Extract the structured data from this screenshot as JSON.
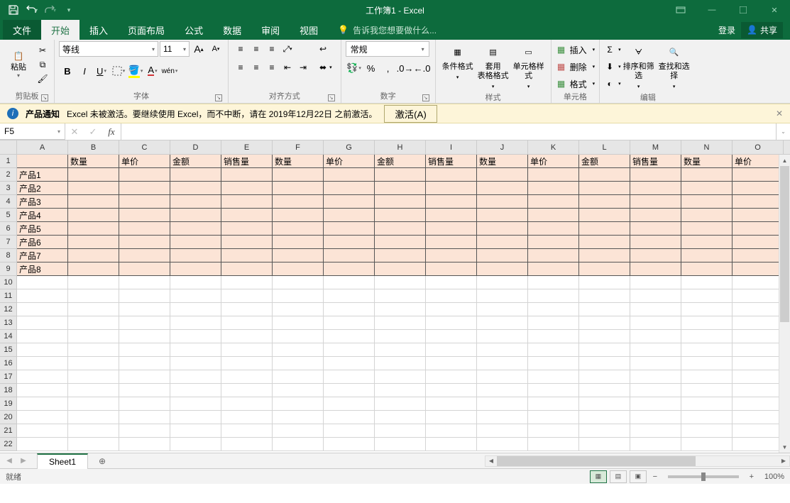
{
  "titlebar": {
    "title": "工作簿1 - Excel"
  },
  "tabs": {
    "file": "文件",
    "items": [
      "开始",
      "插入",
      "页面布局",
      "公式",
      "数据",
      "审阅",
      "视图"
    ],
    "active": 0,
    "tell_me": "告诉我您想要做什么...",
    "login": "登录",
    "share": "共享"
  },
  "ribbon": {
    "clipboard": {
      "label": "剪贴板",
      "paste": "粘贴"
    },
    "font": {
      "label": "字体",
      "name": "等线",
      "size": "11",
      "bold": "B",
      "italic": "I",
      "underline": "U",
      "wen": "wén"
    },
    "align": {
      "label": "对齐方式"
    },
    "number": {
      "label": "数字",
      "format": "常规"
    },
    "styles": {
      "label": "样式",
      "cond": "条件格式",
      "table": "套用\n表格格式",
      "cell": "单元格样式"
    },
    "cells": {
      "label": "单元格",
      "insert": "插入",
      "delete": "删除",
      "format": "格式"
    },
    "editing": {
      "label": "编辑",
      "sort": "排序和筛选",
      "find": "查找和选择"
    }
  },
  "notif": {
    "title": "产品通知",
    "msg": "Excel 未被激活。要继续使用 Excel，而不中断，请在 2019年12月22日 之前激活。",
    "btn": "激活(A)"
  },
  "namebox": "F5",
  "columns": [
    "A",
    "B",
    "C",
    "D",
    "E",
    "F",
    "G",
    "H",
    "I",
    "J",
    "K",
    "L",
    "M",
    "N",
    "O"
  ],
  "row_count": 22,
  "headers_row1": [
    "",
    "数量",
    "单价",
    "金额",
    "销售量",
    "数量",
    "单价",
    "金额",
    "销售量",
    "数量",
    "单价",
    "金额",
    "销售量",
    "数量",
    "单价"
  ],
  "products": [
    "产品1",
    "产品2",
    "产品3",
    "产品4",
    "产品5",
    "产品6",
    "产品7",
    "产品8"
  ],
  "sheet": {
    "name": "Sheet1"
  },
  "status": {
    "ready": "就绪",
    "zoom": "100%"
  }
}
